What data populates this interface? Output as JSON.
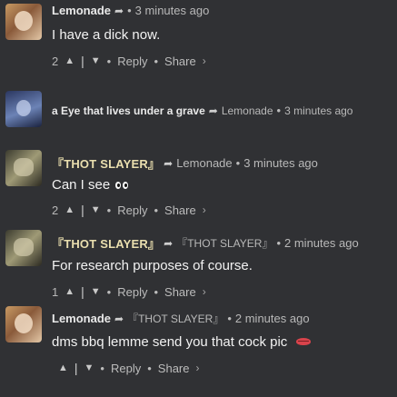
{
  "icons": {
    "reply_to": "arrow-right-icon",
    "upvote": "caret-up-icon",
    "downvote": "caret-down-icon",
    "share_chevron": "chevron-right-icon"
  },
  "comments": [
    {
      "author": "Lemonade",
      "reply_to": "",
      "time": "3 minutes ago",
      "text": "I have a dick now.",
      "votes": "2",
      "reply_label": "Reply",
      "share_label": "Share"
    },
    {
      "author": "a Eye that lives under a grave",
      "reply_to": "Lemonade",
      "time": "3 minutes ago",
      "text": "",
      "votes": "",
      "reply_label": "",
      "share_label": ""
    },
    {
      "author": "『THOT SLAYER』",
      "reply_to": "Lemonade",
      "time": "3 minutes ago",
      "text": "Can I see",
      "votes": "2",
      "reply_label": "Reply",
      "share_label": "Share"
    },
    {
      "author": "『THOT SLAYER』",
      "reply_to": "『THOT SLAYER』",
      "time": "2 minutes ago",
      "text": "For research purposes of course.",
      "votes": "1",
      "reply_label": "Reply",
      "share_label": "Share"
    },
    {
      "author": "Lemonade",
      "reply_to": "『THOT SLAYER』",
      "time": "2 minutes ago",
      "text": "dms bbq lemme send you that cock pic",
      "votes": "",
      "reply_label": "Reply",
      "share_label": "Share"
    }
  ]
}
